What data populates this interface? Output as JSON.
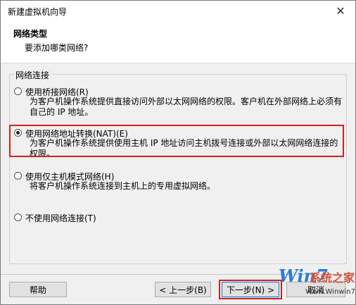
{
  "window": {
    "title": "新建虚拟机向导",
    "close_label": "✕"
  },
  "header": {
    "title": "网络类型",
    "subtitle": "要添加哪类网络?"
  },
  "group": {
    "label": "网络连接",
    "options": [
      {
        "label": "使用桥接网络(R)",
        "description": "为客户机操作系统提供直接访问外部以太网网络的权限。客户机在外部网络上必须有自己的 IP 地址。",
        "checked": false
      },
      {
        "label": "使用网络地址转换(NAT)(E)",
        "description": "为客户机操作系统提供使用主机 IP 地址访问主机拨号连接或外部以太网网络连接的权限。",
        "checked": true
      },
      {
        "label": "使用仅主机模式网络(H)",
        "description": "将客户机操作系统连接到主机上的专用虚拟网络。",
        "checked": false
      },
      {
        "label": "不使用网络连接(T)",
        "description": "",
        "checked": false
      }
    ]
  },
  "buttons": {
    "help": "帮助",
    "back": "< 上一步(B)",
    "next": "下一步(N) >",
    "cancel": "取消"
  },
  "watermark": {
    "logo": "Win7",
    "text": "系统之家",
    "url": "Www.Winwin7.com"
  },
  "colors": {
    "highlight": "#d41f1f",
    "watermark_blue": "#2b7bd6",
    "watermark_red": "#d4513b"
  }
}
